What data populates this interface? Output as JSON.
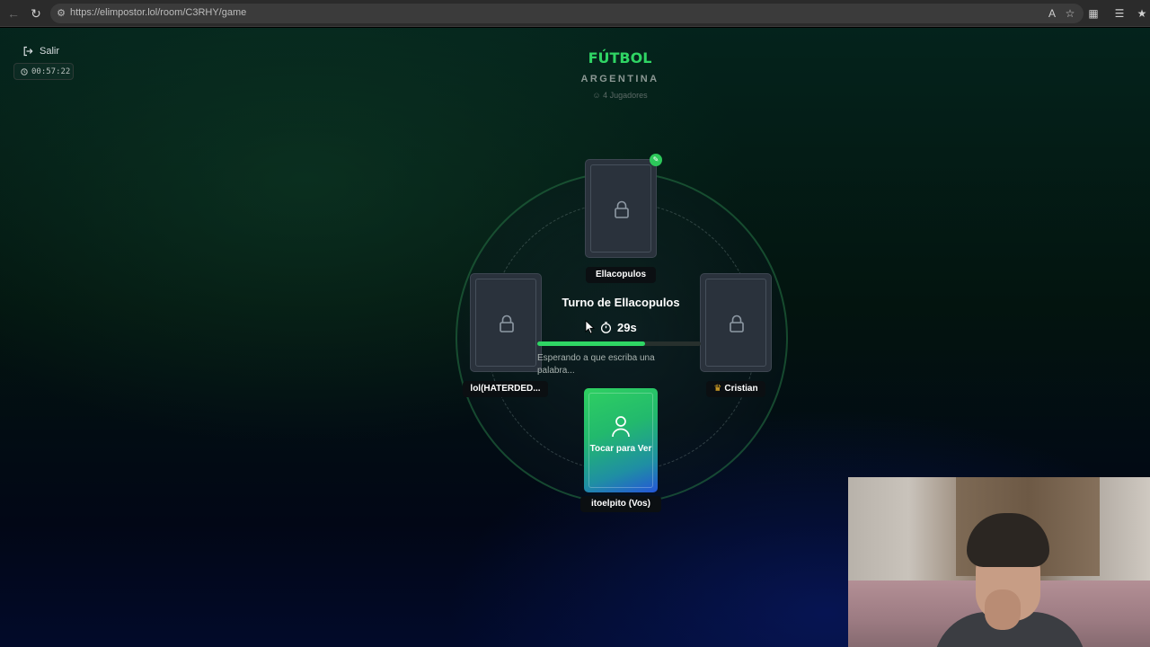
{
  "browser": {
    "url": "https://elimpostor.lol/room/C3RHY/game"
  },
  "game": {
    "exit_label": "Salir",
    "elapsed": "00:57:22",
    "category": "FÚTBOL",
    "subcategory": "ARGENTINA",
    "players_count": "4 Jugadores",
    "turn_title": "Turno de Ellacopulos",
    "countdown": "29s",
    "progress_fraction": 0.66,
    "waiting_text": "Esperando a que escriba una palabra...",
    "accent_color": "#2fd564"
  },
  "players": {
    "top": {
      "name": "Ellacopulos",
      "card_state": "locked",
      "active": true
    },
    "left": {
      "name": "lol(HATERDED...",
      "card_state": "locked"
    },
    "right": {
      "name": "Cristian",
      "card_state": "locked",
      "host": true
    },
    "me": {
      "name": "itoelpito (Vos)",
      "card_label": "Tocar para Ver"
    }
  }
}
